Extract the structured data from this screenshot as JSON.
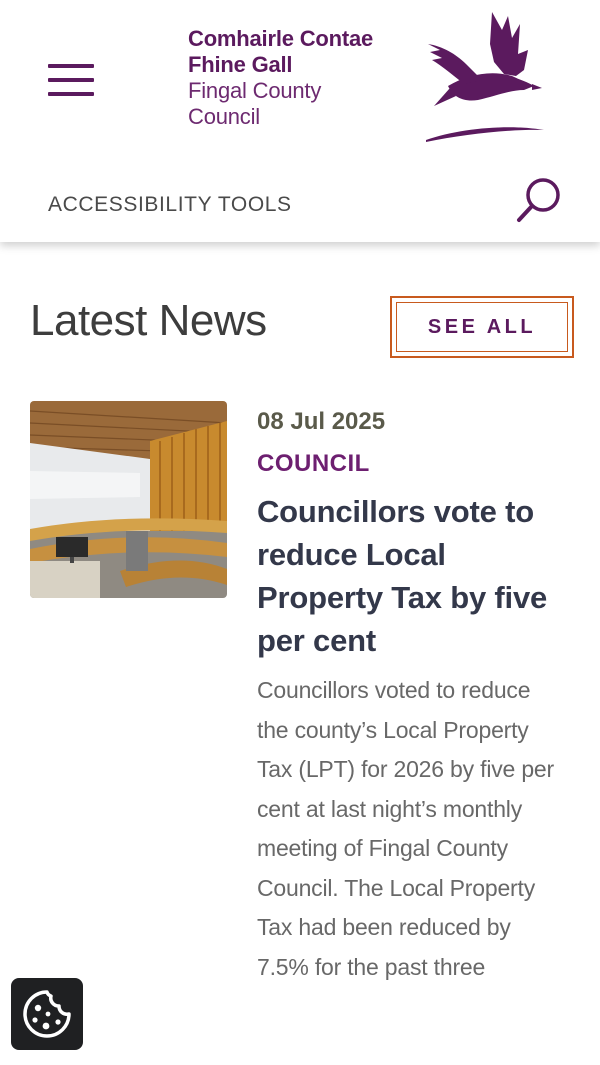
{
  "header": {
    "logo": {
      "line1": "Comhairle Contae",
      "line2": "Fhine Gall",
      "line3": "Fingal County",
      "line4": "Council"
    },
    "accessibility_label": "ACCESSIBILITY TOOLS",
    "icons": {
      "menu": "hamburger-menu-icon",
      "search": "search-icon",
      "logo": "bird-logo-icon"
    }
  },
  "colors": {
    "brand_purple": "#5b1a5e",
    "accent_orange": "#c85a1e",
    "title_dark": "#33384a"
  },
  "news": {
    "heading": "Latest News",
    "see_all_label": "SEE ALL",
    "article": {
      "date": "08 Jul 2025",
      "category": "COUNCIL",
      "title": "Councillors vote to reduce Local Property Tax by five per cent",
      "summary": "Councillors voted to reduce the county’s Local Property Tax (LPT) for 2026 by five per cent at last night’s monthly meeting of Fingal County Council. The Local Property Tax had been reduced by 7.5% for the past three"
    }
  },
  "cookie": {
    "icon": "cookie-icon"
  }
}
